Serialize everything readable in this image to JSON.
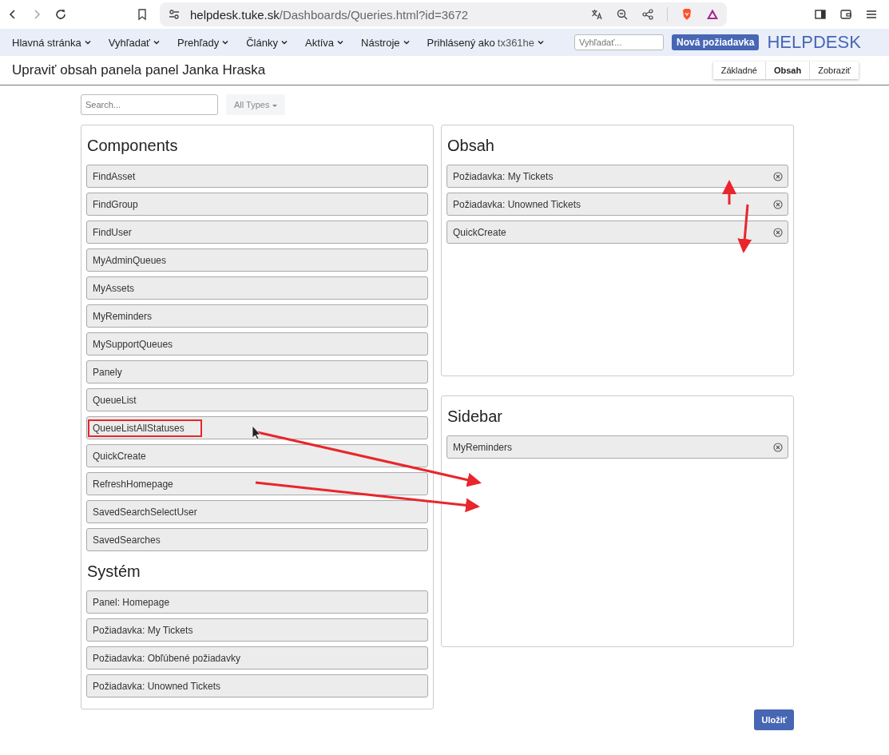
{
  "browser": {
    "url_host": "helpdesk.tuke.sk",
    "url_path": "/Dashboards/Queries.html?id=3672"
  },
  "nav": {
    "items": [
      {
        "label": "Hlavná stránka"
      },
      {
        "label": "Vyhľadať"
      },
      {
        "label": "Prehľady"
      },
      {
        "label": "Články"
      },
      {
        "label": "Aktíva"
      },
      {
        "label": "Nástroje"
      }
    ],
    "user_label": "Prihlásený ako",
    "user_name": "tx361he",
    "search": {
      "placeholder": "Vyhľadať..."
    },
    "new_button": "Nová požiadavka",
    "logo": "HELPDESK"
  },
  "page_title": "Upraviť obsah panela panel Janka Hraska",
  "tabs": [
    {
      "label": "Základné",
      "selected": false
    },
    {
      "label": "Obsah",
      "selected": true
    },
    {
      "label": "Zobraziť",
      "selected": false
    }
  ],
  "search": {
    "placeholder": "Search..."
  },
  "type_filter": "All Types",
  "available": {
    "groups": [
      {
        "title": "Components",
        "items": [
          {
            "label": "FindAsset",
            "highlighted": false
          },
          {
            "label": "FindGroup",
            "highlighted": false
          },
          {
            "label": "FindUser",
            "highlighted": false
          },
          {
            "label": "MyAdminQueues",
            "highlighted": false
          },
          {
            "label": "MyAssets",
            "highlighted": false
          },
          {
            "label": "MyReminders",
            "highlighted": false
          },
          {
            "label": "MySupportQueues",
            "highlighted": false
          },
          {
            "label": "Panely",
            "highlighted": false
          },
          {
            "label": "QueueList",
            "highlighted": false
          },
          {
            "label": "QueueListAllStatuses",
            "highlighted": true
          },
          {
            "label": "QuickCreate",
            "highlighted": false
          },
          {
            "label": "RefreshHomepage",
            "highlighted": false
          },
          {
            "label": "SavedSearchSelectUser",
            "highlighted": false
          },
          {
            "label": "SavedSearches",
            "highlighted": false
          }
        ]
      },
      {
        "title": "Systém",
        "items": [
          {
            "label": "Panel: Homepage",
            "highlighted": false
          },
          {
            "label": "Požiadavka: My Tickets",
            "highlighted": false
          },
          {
            "label": "Požiadavka: Obľúbené požiadavky",
            "highlighted": false
          },
          {
            "label": "Požiadavka: Unowned Tickets",
            "highlighted": false
          }
        ]
      }
    ]
  },
  "targets": [
    {
      "title": "Obsah",
      "items": [
        {
          "label": "Požiadavka: My Tickets"
        },
        {
          "label": "Požiadavka: Unowned Tickets"
        },
        {
          "label": "QuickCreate"
        }
      ]
    },
    {
      "title": "Sidebar",
      "items": [
        {
          "label": "MyReminders"
        }
      ]
    }
  ],
  "save_button": "Uložiť"
}
